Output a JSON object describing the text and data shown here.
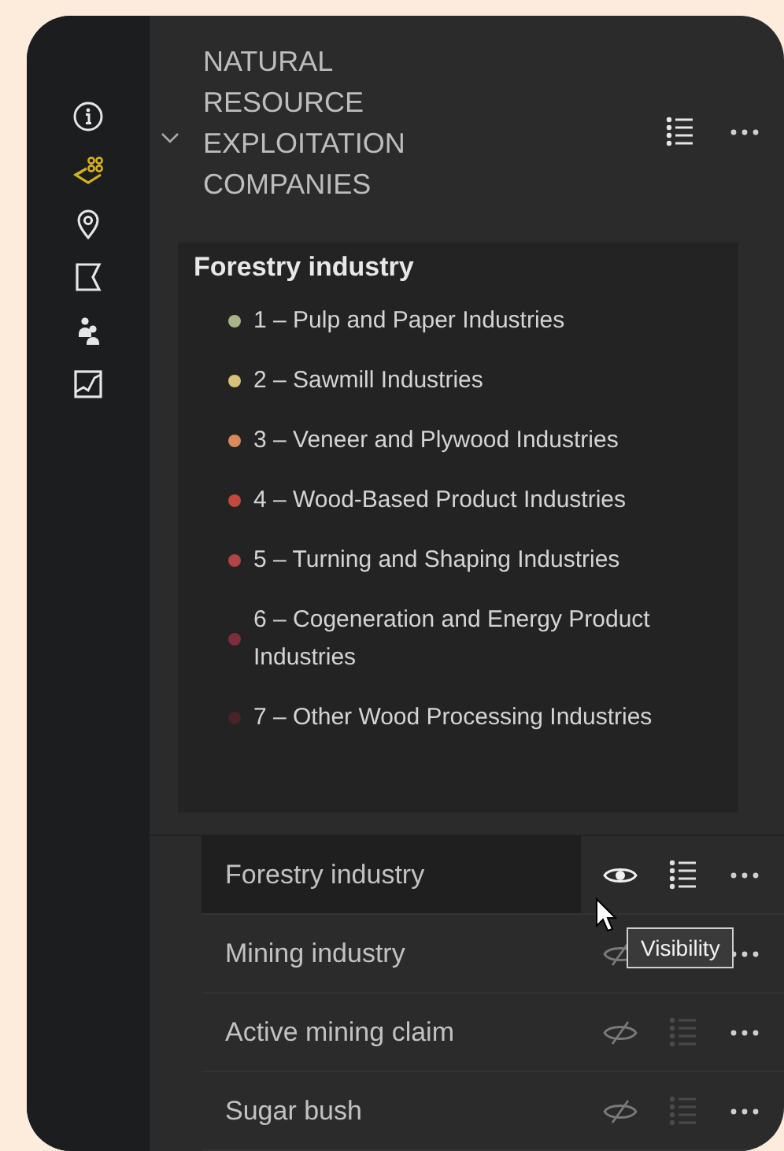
{
  "rail": {
    "items": [
      {
        "kind": "info",
        "selected": false
      },
      {
        "kind": "layers",
        "selected": true
      },
      {
        "kind": "pin",
        "selected": false
      },
      {
        "kind": "flag",
        "selected": false
      },
      {
        "kind": "people",
        "selected": false
      },
      {
        "kind": "chart",
        "selected": false
      }
    ]
  },
  "group": {
    "title": "NATURAL RESOURCE EXPLOITATION COMPANIES",
    "expanded": true
  },
  "legend": {
    "title": "Forestry industry",
    "items": [
      {
        "label": "1 – Pulp and Paper Industries",
        "color": "#a9b486"
      },
      {
        "label": "2 – Sawmill Industries",
        "color": "#d8c27a"
      },
      {
        "label": "3 – Veneer and Plywood Industries",
        "color": "#d9895a"
      },
      {
        "label": "4 – Wood-Based Product Industries",
        "color": "#c4483e"
      },
      {
        "label": "5 – Turning and Shaping Industries",
        "color": "#b04446"
      },
      {
        "label": "6 – Cogeneration and Energy Product Industries",
        "color": "#7e2e3a"
      },
      {
        "label": "7 – Other Wood Processing Industries",
        "color": "#4a2228"
      }
    ]
  },
  "layers": [
    {
      "name": "Forestry industry",
      "visible": true,
      "selected": true
    },
    {
      "name": "Mining industry",
      "visible": false,
      "selected": false
    },
    {
      "name": "Active mining claim",
      "visible": false,
      "selected": false
    },
    {
      "name": "Sugar bush",
      "visible": false,
      "selected": false
    }
  ],
  "tooltip": {
    "text": "Visibility"
  }
}
